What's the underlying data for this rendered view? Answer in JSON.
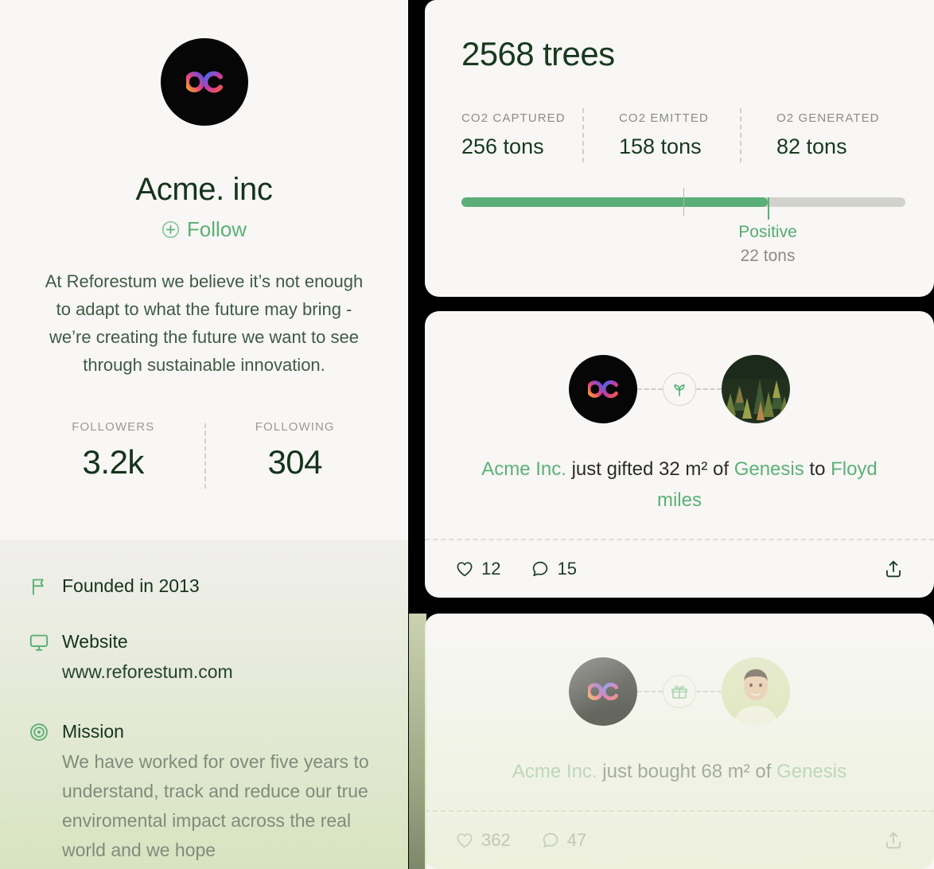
{
  "profile": {
    "logo_alt": "ac-logo",
    "name": "Acme. inc",
    "follow_label": "Follow",
    "bio": "At Reforestum we believe it’s not enough to adapt to what the future may bring - we’re creating the future we want to see through sustainable innovation.",
    "stats": [
      {
        "label": "FOLLOWERS",
        "value": "3.2k"
      },
      {
        "label": "FOLLOWING",
        "value": "304"
      }
    ],
    "info": [
      {
        "icon": "flag-icon",
        "title": "Founded in 2013"
      },
      {
        "icon": "monitor-icon",
        "title": "Website",
        "sub": "www.reforestum.com"
      },
      {
        "icon": "target-icon",
        "title": "Mission",
        "body": "We have worked for over five years to understand, track and reduce our true enviromental impact across the real world and we hope"
      }
    ]
  },
  "impact": {
    "title": "2568 trees",
    "metrics": [
      {
        "label": "CO2 CAPTURED",
        "value": "256 tons"
      },
      {
        "label": "CO2 EMITTED",
        "value": "158 tons"
      },
      {
        "label": "O2 GENERATED",
        "value": "82 tons"
      }
    ],
    "bar": {
      "fill_percent": 69,
      "midtick_percent": 50,
      "status": "Positive",
      "amount": "22 tons",
      "fill_color": "#5BAE77",
      "track_color": "#D2D2CC"
    }
  },
  "feed": [
    {
      "badge_icon": "seedling-icon",
      "right_avatar": "forest-photo",
      "text_parts": [
        {
          "t": "Acme Inc.",
          "green": true
        },
        {
          "t": " just gifted 32 m² of ",
          "green": false
        },
        {
          "t": "Genesis",
          "green": true
        },
        {
          "t": " to ",
          "green": false
        },
        {
          "t": "Floyd miles",
          "green": true
        }
      ],
      "likes": "12",
      "comments": "15"
    },
    {
      "badge_icon": "gift-icon",
      "right_avatar": "person-photo",
      "text_parts": [
        {
          "t": "Acme Inc.",
          "green": true
        },
        {
          "t": " just bought 68 m² of ",
          "green": false
        },
        {
          "t": "Genesis",
          "green": true
        }
      ],
      "likes": "362",
      "comments": "47"
    }
  ],
  "colors": {
    "accent_green": "#5CB176",
    "dark_green": "#17391F",
    "card_bg": "#F8F7F5",
    "page_bg": "#000000"
  }
}
